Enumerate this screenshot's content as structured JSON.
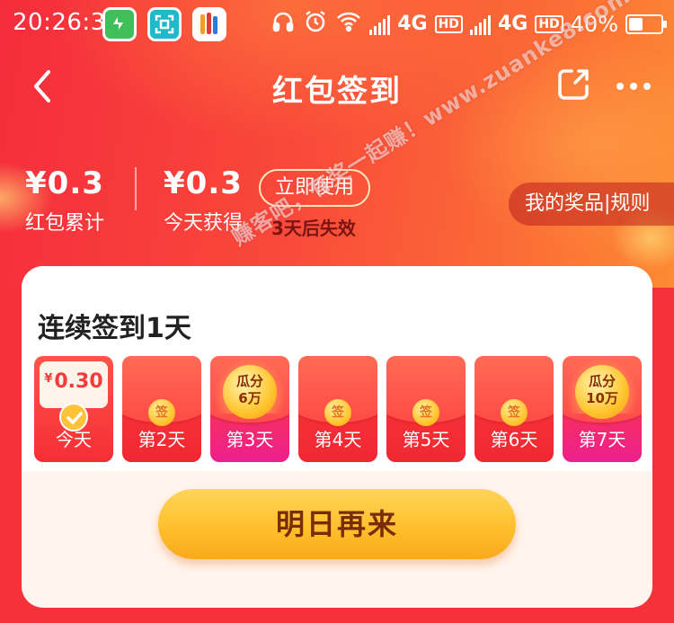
{
  "status_bar": {
    "time": "20:26:33",
    "network_1": "4G",
    "hd_1": "HD",
    "network_2": "4G",
    "hd_2": "HD",
    "battery": "40%",
    "battery_level": 0.4,
    "icons": [
      "battery-saver-app-icon",
      "scan-app-icon",
      "shopping-app-icon",
      "headset-icon",
      "alarm-icon",
      "wifi-icon",
      "signal-icon"
    ]
  },
  "nav": {
    "title": "红包签到"
  },
  "stats": {
    "total_value": "¥0.3",
    "total_label": "红包累计",
    "today_value": "¥0.3",
    "today_label": "今天获得",
    "use_button": "立即使用",
    "expire_note": "3天后失效",
    "prize_rules": "我的奖品|规则"
  },
  "checkin": {
    "title": "连续签到1天",
    "today_amount": "0.30",
    "currency": "¥",
    "coin_char": "签",
    "days": [
      {
        "label": "今天"
      },
      {
        "label": "第2天"
      },
      {
        "label": "第3天",
        "prize": "瓜分\n6万"
      },
      {
        "label": "第4天"
      },
      {
        "label": "第5天"
      },
      {
        "label": "第6天"
      },
      {
        "label": "第7天",
        "prize": "瓜分\n10万"
      }
    ],
    "day3_prize_top": "瓜分",
    "day3_prize_bottom": "6万",
    "day7_prize_top": "瓜分",
    "day7_prize_bottom": "10万",
    "main_button": "明日再来"
  },
  "watermark": "赚客吧，有奖一起赚！www.zuanke8.com",
  "colors": {
    "brand_red": "#f5313a",
    "accent_gold": "#ffc02c",
    "button_text": "#7a2c06"
  }
}
